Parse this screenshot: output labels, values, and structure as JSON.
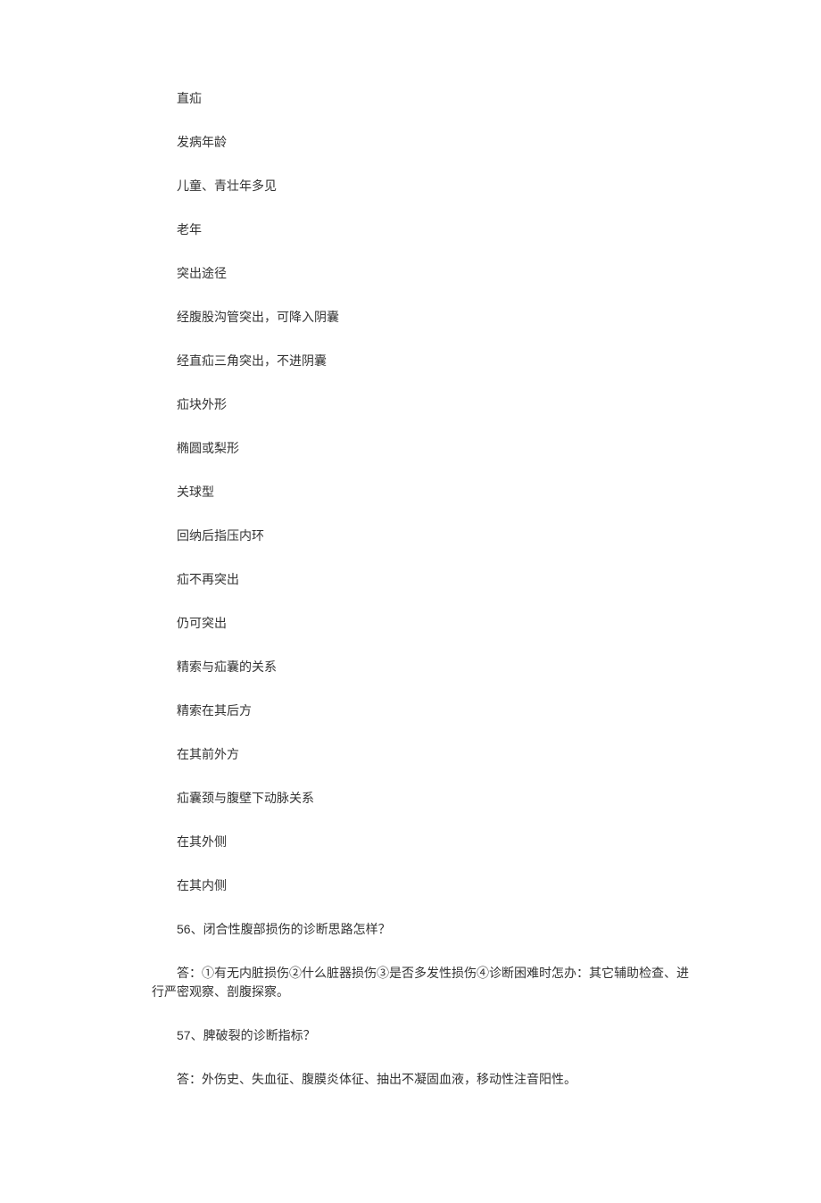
{
  "lines": [
    "直疝",
    "发病年龄",
    "儿童、青壮年多见",
    "老年",
    "突出途径",
    "经腹股沟管突出，可降入阴囊",
    "经直疝三角突出，不进阴囊",
    "疝块外形",
    "椭圆或梨形",
    "关球型",
    "回纳后指压内环",
    "疝不再突出",
    "仍可突出",
    "精索与疝囊的关系",
    "精索在其后方",
    "在其前外方",
    "疝囊颈与腹壁下动脉关系",
    "在其外侧",
    "在其内侧"
  ],
  "q56": {
    "num": "56",
    "sep": "、",
    "title": "闭合性腹部损伤的诊断思路怎样？",
    "ans_label": "答：",
    "ans_body": "①有无内脏损伤②什么脏器损伤③是否多发性损伤④诊断困难时怎办：其它辅助检查、进行严密观察、剖腹探察。"
  },
  "q57": {
    "num": "57",
    "sep": "、",
    "title": "脾破裂的诊断指标？",
    "ans_label": "答：",
    "ans_body": "外伤史、失血征、腹膜炎体征、抽出不凝固血液，移动性注音阳性。"
  }
}
